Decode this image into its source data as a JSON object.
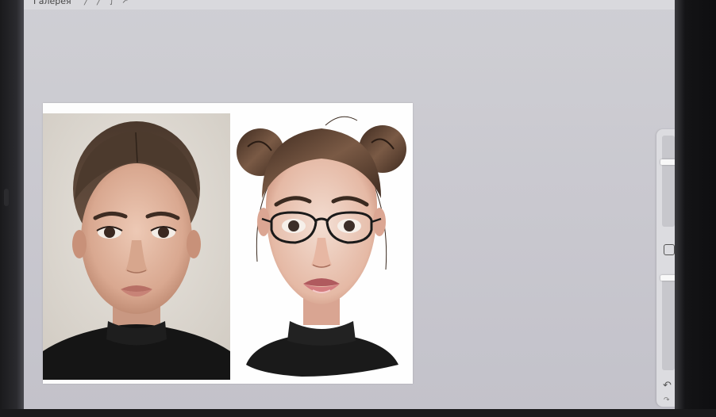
{
  "app": {
    "gallery_label": "Галерея",
    "tool_icons": [
      "wrench-icon",
      "magic-wand-icon",
      "selection-icon",
      "transform-icon"
    ]
  },
  "canvas": {
    "panels": [
      "reference-photo",
      "illustrated-portrait"
    ]
  },
  "sidebar": {
    "controls": [
      "brush-size-slider",
      "modify-button",
      "opacity-slider",
      "undo-button",
      "redo-button"
    ],
    "undo_glyph": "↶",
    "redo_glyph": "↷"
  },
  "colors": {
    "screen_bg": "#c9c8cf",
    "bezel": "#121214",
    "hair": "#5a4030",
    "sweater": "#1a1a1a"
  }
}
